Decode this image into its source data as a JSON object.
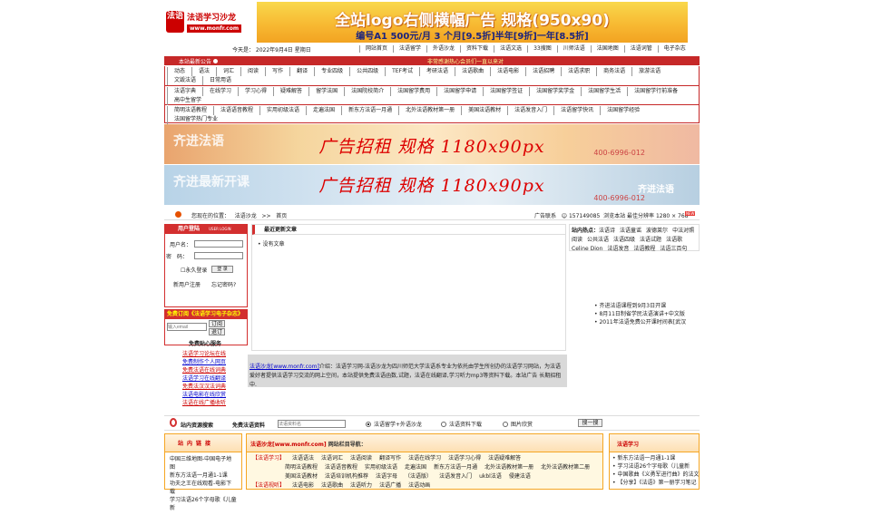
{
  "header": {
    "logo_seal": "法语",
    "logo_name": "法语学习沙龙",
    "logo_url": "www.monfr.com",
    "banner_line1": "全站logo右侧横幅广告 规格(950x90)",
    "banner_line2": "编号A1 500元/月 3 个月[9.5折]半年[9折]一年[8.5折]"
  },
  "today": {
    "date": "今天是： 2022年9月4日 星期日",
    "nav": [
      "网站首页",
      "法语留学",
      "外语沙龙",
      "资料下载",
      "法语文选",
      "33搜图",
      "川师法语",
      "法国地图",
      "法语词管",
      "电子杂志"
    ]
  },
  "navbar": {
    "announcement": "本站最新公告",
    "marquee": "非常感谢热心会员们一直以来对"
  },
  "categories": {
    "row1": [
      "动态",
      "语法",
      "词汇",
      "阅读",
      "写作",
      "翻译",
      "专业四级",
      "公共四级",
      "TEF考试",
      "考研法语",
      "法语歌曲",
      "法语电影",
      "法语招聘",
      "法语求职",
      "商务法语",
      "旅游法语",
      "文毁法语",
      "日常用语"
    ],
    "row2": [
      "法语字典",
      "在线学习",
      "学习心得",
      "疑难解答",
      "留学法国",
      "法国院校简介",
      "法国留学费用",
      "法国留学申请",
      "法国留学签证",
      "法国留学奖学金",
      "法国留学生活",
      "法国留学行前准备",
      "高中生留学"
    ],
    "row3": [
      "简明法语教程",
      "法语语音教程",
      "实用初级法语",
      "走遍法国",
      "新东方法语一月通",
      "北外法语教材第一册",
      "美国法语教材",
      "法语发音入门",
      "法语留学快讯",
      "法国留学经验",
      "法国留学热门专业"
    ]
  },
  "ads": {
    "ad1_text": "广告招租 规格 1180x90px",
    "ad1_bg_title": "齐进法语",
    "ad1_bg_phone": "400-6996-012",
    "ad2_text": "广告招租 规格 1180x90px",
    "ad2_bg_title": "齐进最新开课",
    "ad2_bg_right": "齐进法语",
    "ad2_bg_phone": "400-6996-012"
  },
  "path": {
    "label": "您现在的位置：",
    "site": "法语沙龙",
    "sep": ">>",
    "current": "首页",
    "contact": "广告联系",
    "qq": "157149085",
    "browse_note": "浏览本站 最佳分辨率 1280 × 768",
    "badge": "NEW"
  },
  "login": {
    "title": "用户登陆",
    "title_en": "USER LOGIN",
    "username_label": "用户名：",
    "password_label": "密　码：",
    "remember": "永久登录",
    "submit": "登 录",
    "register": "新用户注册",
    "forgot": "忘记密码?"
  },
  "subscribe": {
    "title": "免费订阅《法语学习电子杂志》",
    "placeholder": "输入email",
    "subscribe_btn": "订阅",
    "unsubscribe_btn": "退订",
    "center": "免费贴心服务"
  },
  "services": [
    "法语学习论坛在线",
    "免费制作个人网页",
    "免费法语在线词典",
    "法语学习在线翻译",
    "免费法汉汉法词典",
    "法语电影在线欣赏",
    "法语在线广播收听"
  ],
  "recent": {
    "title": "最近更新文章",
    "empty": "没有文章"
  },
  "intro": {
    "brand": "法语沙龙[www.monfr.com]",
    "text": "介绍：法语学习网-法语沙龙为四川师范大学法语系专业为依托由学生所创办的法语学习网站，为法语爱好者提供法语学习交流的网上空间，本站提供免费法语函数,试题，法语在线翻译,学习听力mp3等资料下载。本站广告 长期招租中."
  },
  "hot": {
    "label": "站内热点：",
    "tags": [
      "法语诗",
      "法语童谣",
      "波德莱尔",
      "中法对照阅读",
      "公共法语",
      "法语四级",
      "法语试题",
      "法语歌 Celine Dion",
      "法语发音",
      "法语教程",
      "法语三百句"
    ]
  },
  "news": [
    "齐进法语课程到9月3日开课",
    "8月11日制省学民法语演讲+中文版",
    "2011年法语免费公开课时间表[武汉"
  ],
  "search": {
    "label": "站内资源搜索",
    "label2": "免费法语资料",
    "placeholder": "法语资料名",
    "options": [
      "法语留学+外语沙龙",
      "法语资料下载",
      "图片欣赏"
    ],
    "button": "搜一搜"
  },
  "friend_links": {
    "title": "站内链接",
    "items": [
      "中国三维地图-中国电子地图",
      "新东方法语一月通1-1课",
      "功夫之王在线观看-电影下载",
      "学习法语26个字母歌《儿童新"
    ]
  },
  "columns": {
    "brand": "法语沙龙[www.monfr.com]",
    "title": "网站栏目导航：",
    "rows": [
      {
        "tag": "【法语学习】",
        "items": [
          "法语语法",
          "法语词汇",
          "法语阅读",
          "翻译写作",
          "法语在线学习",
          "法语学习心得",
          "法语疑难解答"
        ]
      },
      {
        "tag": "",
        "items": [
          "简明法语教程",
          "法语语音教程",
          "实用初级法语",
          "走遍法国",
          "新东方法语一月通",
          "北外法语教材第一册",
          "北外法语教材第二册"
        ]
      },
      {
        "tag": "",
        "items": [
          "美国法语教材",
          "法语培训机构推荐",
          "法语字母",
          "（法语版）",
          "法语发音入门",
          "ukbl法语",
          "侵建法语"
        ]
      },
      {
        "tag": "【法语视听】",
        "items": [
          "法语电影",
          "法语歌曲",
          "法语听力",
          "法语广播",
          "法语动画"
        ]
      }
    ]
  },
  "learning": {
    "title": "法语学习",
    "items": [
      "新东方法语一月通1-1课",
      "学习法语26个字母歌（儿童新",
      "中国歌曲《义勇军进行曲》的法文",
      "【分享】《法语》第一册学习笔记"
    ]
  }
}
